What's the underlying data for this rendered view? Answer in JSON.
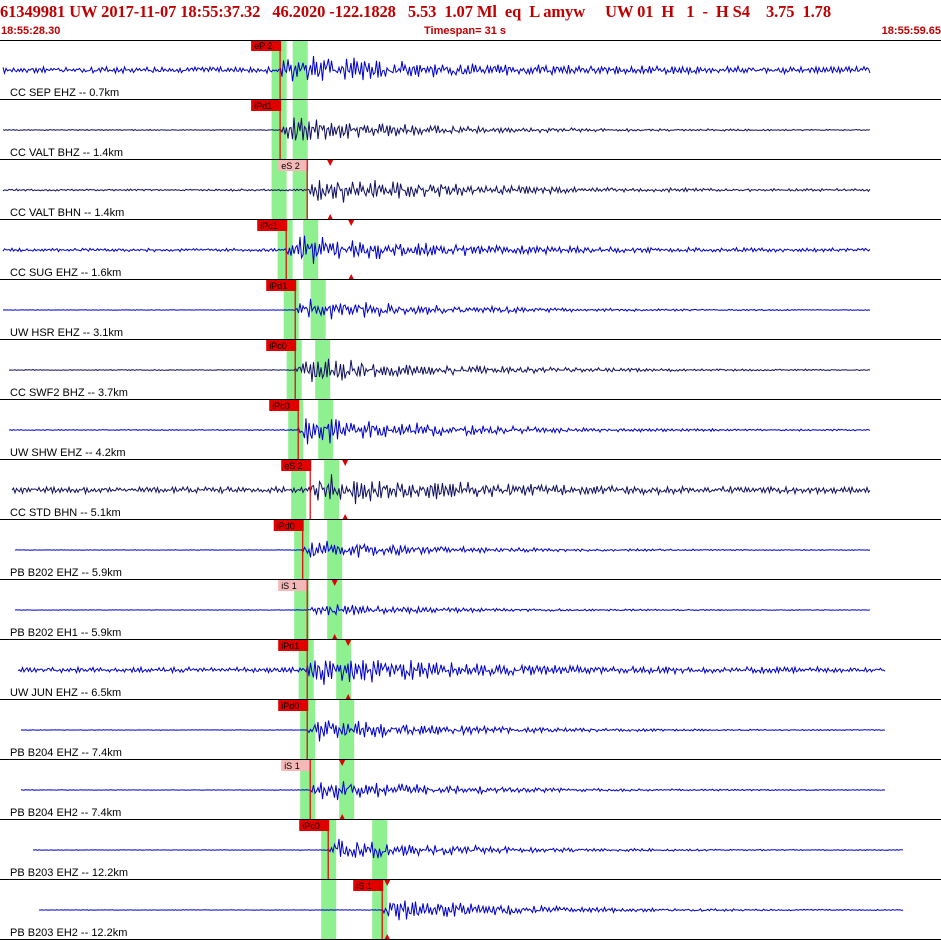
{
  "header": {
    "title": "61349981 UW 2017-11-07 18:55:37.32   46.2020 -122.1828   5.53  1.07 Ml  eq  L amyw     UW 01  H   1  -  H S4    3.75  1.78",
    "start_time": "18:55:28.30",
    "timespan": "Timespan=  31 s",
    "end_time": "18:55:59.65"
  },
  "colors": {
    "title": "#c00000",
    "trace_blue": "#0000cc",
    "trace_dark": "#101060",
    "pick_box": "#e00000",
    "pick_box_light": "#f4b8b8",
    "window_green": "#8ef08e",
    "pick_line": "#e00000"
  },
  "traces": [
    {
      "label": "CC SEP EHZ -- 0.7km",
      "color": "blue",
      "pick": "eP 2",
      "pick_light": false,
      "p_t": 9.3,
      "s_t": null,
      "windows": [
        [
          9.05,
          9.55
        ],
        [
          9.75,
          10.25
        ]
      ],
      "amp": 0.55,
      "noise": 0.12,
      "start": 0.0,
      "end": 29.0
    },
    {
      "label": "CC VALT BHZ -- 1.4km",
      "color": "dark",
      "pick": "iPd1",
      "pick_light": false,
      "p_t": 9.3,
      "s_t": null,
      "windows": [
        [
          9.05,
          9.55
        ],
        [
          9.75,
          10.25
        ]
      ],
      "amp": 0.5,
      "noise": 0.02,
      "start": 0.0,
      "end": 29.0
    },
    {
      "label": "CC VALT BHN -- 1.4km",
      "color": "dark",
      "pick": "eS 2",
      "pick_light": true,
      "p_t": 10.2,
      "s_t": 11.0,
      "windows": [
        [
          9.05,
          9.55
        ],
        [
          9.75,
          10.25
        ]
      ],
      "amp": 0.55,
      "noise": 0.04,
      "start": 0.0,
      "end": 29.0
    },
    {
      "label": "CC SUG EHZ -- 1.6km",
      "color": "blue",
      "pick": "iPc1",
      "pick_light": false,
      "p_t": 9.5,
      "s_t": 11.7,
      "windows": [
        [
          9.25,
          9.75
        ],
        [
          10.1,
          10.6
        ]
      ],
      "amp": 0.6,
      "noise": 0.06,
      "start": 0.0,
      "end": 29.0
    },
    {
      "label": "UW HSR EHZ -- 3.1km",
      "color": "blue",
      "pick": "iPd1",
      "pick_light": false,
      "p_t": 9.8,
      "s_t": null,
      "windows": [
        [
          9.45,
          9.95
        ],
        [
          10.35,
          10.85
        ]
      ],
      "amp": 0.5,
      "noise": 0.01,
      "start": 0.0,
      "end": 29.0
    },
    {
      "label": "CC SWF2 BHZ -- 3.7km",
      "color": "dark",
      "pick": "iPc0",
      "pick_light": false,
      "p_t": 9.8,
      "s_t": null,
      "windows": [
        [
          9.55,
          10.05
        ],
        [
          10.5,
          11.0
        ]
      ],
      "amp": 0.55,
      "noise": 0.02,
      "start": 0.2,
      "end": 29.0
    },
    {
      "label": "UW SHW EHZ -- 4.2km",
      "color": "blue",
      "pick": "iPc0",
      "pick_light": false,
      "p_t": 9.9,
      "s_t": null,
      "windows": [
        [
          9.6,
          10.1
        ],
        [
          10.6,
          11.1
        ]
      ],
      "amp": 0.6,
      "noise": 0.02,
      "start": 0.2,
      "end": 29.0
    },
    {
      "label": "CC STD BHN -- 5.1km",
      "color": "dark",
      "pick": "eS 2",
      "pick_light": false,
      "p_t": 10.3,
      "s_t": 11.5,
      "windows": [
        [
          9.7,
          10.2
        ],
        [
          10.8,
          11.3
        ]
      ],
      "amp": 0.55,
      "noise": 0.12,
      "start": 0.3,
      "end": 29.0
    },
    {
      "label": "PB B202 EHZ -- 5.9km",
      "color": "blue",
      "pick": "iPd0",
      "pick_light": false,
      "p_t": 10.05,
      "s_t": null,
      "windows": [
        [
          9.8,
          10.3
        ],
        [
          10.9,
          11.4
        ]
      ],
      "amp": 0.4,
      "noise": 0.01,
      "start": 0.4,
      "end": 29.0
    },
    {
      "label": "PB B202 EH1 -- 5.9km",
      "color": "blue",
      "pick": "iS 1",
      "pick_light": true,
      "p_t": 10.2,
      "s_t": 11.15,
      "windows": [
        [
          9.8,
          10.3
        ],
        [
          10.9,
          11.4
        ]
      ],
      "amp": 0.25,
      "noise": 0.01,
      "start": 0.4,
      "end": 29.0
    },
    {
      "label": "UW JUN EHZ -- 6.5km",
      "color": "blue",
      "pick": "iPd1",
      "pick_light": false,
      "p_t": 10.2,
      "s_t": 11.6,
      "windows": [
        [
          9.95,
          10.45
        ],
        [
          11.2,
          11.7
        ]
      ],
      "amp": 0.55,
      "noise": 0.1,
      "start": 0.5,
      "end": 29.5
    },
    {
      "label": "PB B204 EHZ -- 7.4km",
      "color": "blue",
      "pick": "iPd0",
      "pick_light": false,
      "p_t": 10.2,
      "s_t": null,
      "windows": [
        [
          10.0,
          10.5
        ],
        [
          11.3,
          11.8
        ]
      ],
      "amp": 0.5,
      "noise": 0.01,
      "start": 0.6,
      "end": 29.5
    },
    {
      "label": "PB B204 EH2 -- 7.4km",
      "color": "blue",
      "pick": "iS 1",
      "pick_light": true,
      "p_t": 10.3,
      "s_t": 11.4,
      "windows": [
        [
          10.0,
          10.5
        ],
        [
          11.3,
          11.8
        ]
      ],
      "amp": 0.45,
      "noise": 0.01,
      "start": 0.6,
      "end": 29.5
    },
    {
      "label": "PB B203 EHZ -- 12.2km",
      "color": "blue",
      "pick": "iPc0",
      "pick_light": false,
      "p_t": 10.9,
      "s_t": null,
      "windows": [
        [
          10.7,
          11.2
        ],
        [
          12.4,
          12.9
        ]
      ],
      "amp": 0.45,
      "noise": 0.01,
      "start": 1.0,
      "end": 30.1
    },
    {
      "label": "PB B203 EH2 -- 12.2km",
      "color": "blue",
      "pick": "iS 1",
      "pick_light": false,
      "p_t": 12.7,
      "s_t": 12.9,
      "windows": [
        [
          10.7,
          11.2
        ],
        [
          12.4,
          12.9
        ]
      ],
      "amp": 0.45,
      "noise": 0.01,
      "start": 1.2,
      "end": 30.1
    }
  ]
}
